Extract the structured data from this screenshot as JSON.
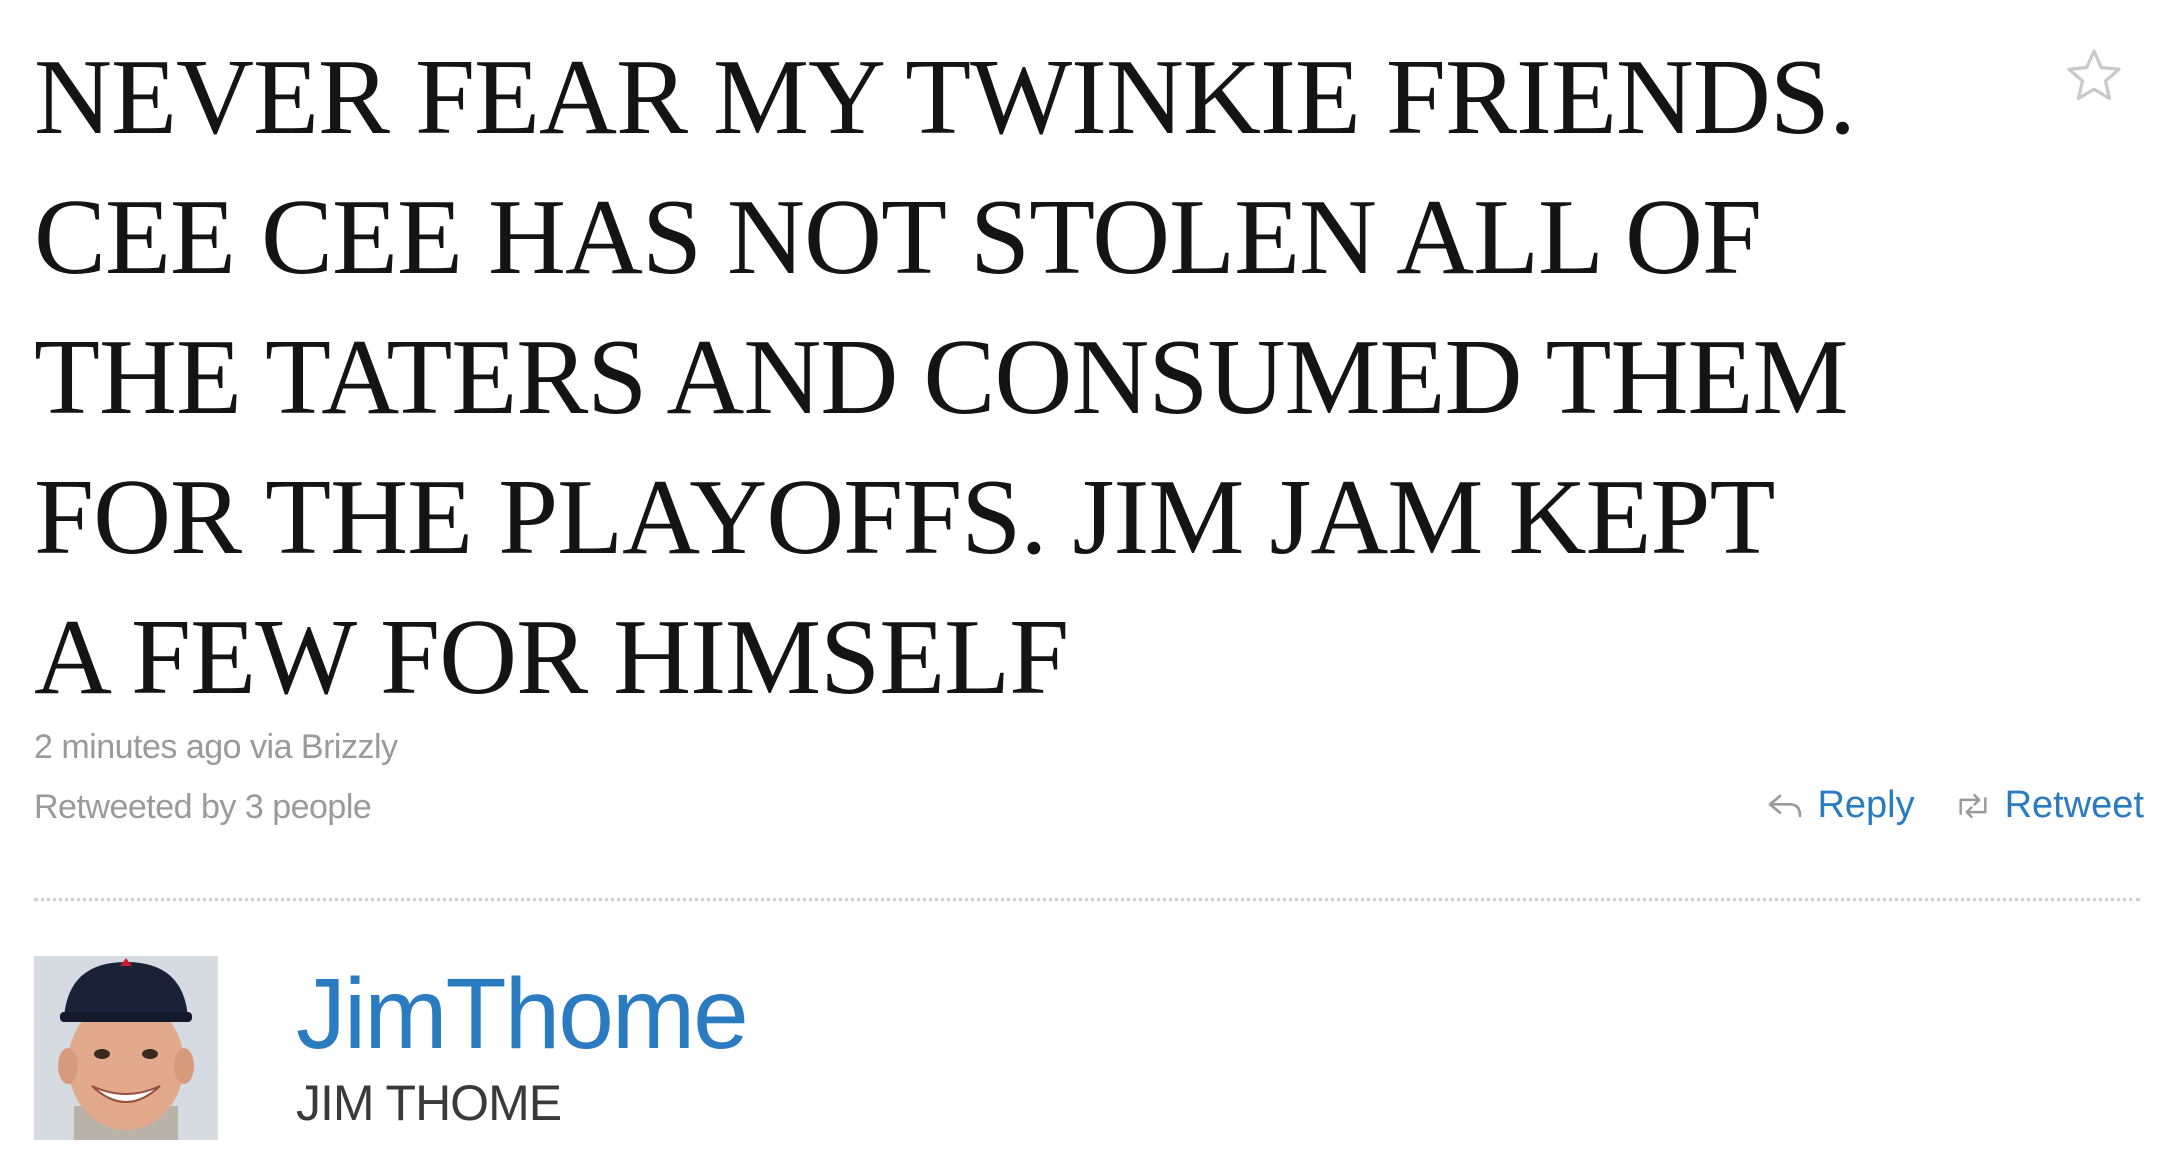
{
  "tweet": {
    "text": "NEVER FEAR MY TWINKIE FRIENDS.\nCEE CEE HAS NOT STOLEN ALL OF\nTHE TATERS AND CONSUMED THEM\nFOR THE PLAYOFFS. JIM JAM KEPT\nA FEW FOR HIMSELF",
    "timestamp": "2 minutes ago via Brizzly",
    "retweeted_by": "Retweeted by 3 people",
    "favorite_icon": "star-icon"
  },
  "actions": {
    "reply_label": "Reply",
    "reply_icon": "reply-arrow-icon",
    "retweet_label": "Retweet",
    "retweet_icon": "retweet-icon"
  },
  "author": {
    "screen_name": "JimThome",
    "full_name": "JIM THOME"
  },
  "colors": {
    "link": "#2a7bc0",
    "meta": "#9a9a9a",
    "text": "#141414"
  }
}
